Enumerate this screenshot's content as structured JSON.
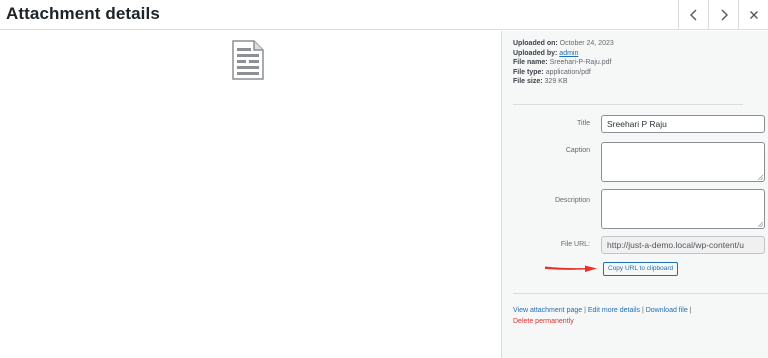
{
  "header": {
    "title": "Attachment details"
  },
  "details": {
    "uploaded_on_label": "Uploaded on:",
    "uploaded_on_value": "October 24, 2023",
    "uploaded_by_label": "Uploaded by:",
    "uploaded_by_value": "admin",
    "file_name_label": "File name:",
    "file_name_value": "Sreehari-P-Raju.pdf",
    "file_type_label": "File type:",
    "file_type_value": "application/pdf",
    "file_size_label": "File size:",
    "file_size_value": "329 KB"
  },
  "form": {
    "title_label": "Title",
    "title_value": "Sreehari P Raju",
    "caption_label": "Caption",
    "caption_value": "",
    "description_label": "Description",
    "description_value": "",
    "file_url_label": "File URL:",
    "file_url_value": "http://just-a-demo.local/wp-content/u",
    "copy_button_label": "Copy URL to clipboard"
  },
  "links": {
    "view_attachment": "View attachment page",
    "edit_details": "Edit more details",
    "download_file": "Download file",
    "separator": " | ",
    "trailing_separator": " |",
    "delete": "Delete permanently"
  },
  "colors": {
    "accent": "#2271b1",
    "danger": "#d63638",
    "annotation_arrow": "#e8312b"
  }
}
